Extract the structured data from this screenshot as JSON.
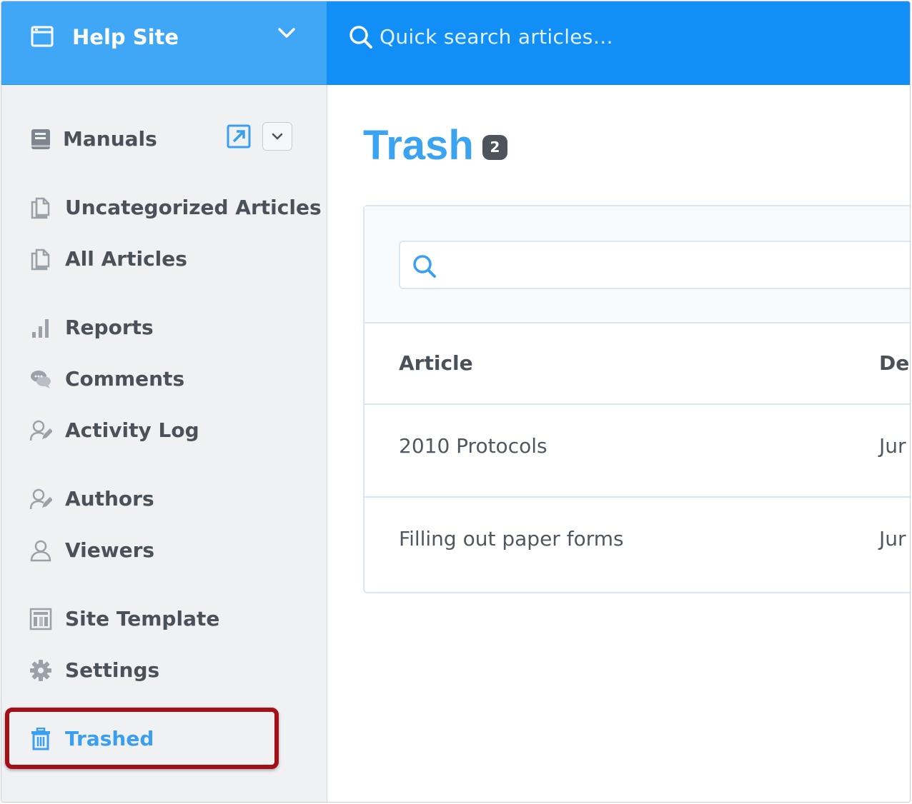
{
  "site": {
    "name": "Help Site"
  },
  "search": {
    "placeholder": "Quick search articles…"
  },
  "sidebar": {
    "items": [
      {
        "label": "Manuals"
      },
      {
        "label": "Uncategorized Articles"
      },
      {
        "label": "All Articles"
      },
      {
        "label": "Reports"
      },
      {
        "label": "Comments"
      },
      {
        "label": "Activity Log"
      },
      {
        "label": "Authors"
      },
      {
        "label": "Viewers"
      },
      {
        "label": "Site Template"
      },
      {
        "label": "Settings"
      },
      {
        "label": "Trashed"
      }
    ]
  },
  "main": {
    "title": "Trash",
    "count": "2",
    "filter": {
      "value": ""
    },
    "table": {
      "columns": [
        "Article",
        "Del"
      ],
      "rows": [
        {
          "article": "2010 Protocols",
          "date": "Jur"
        },
        {
          "article": "Filling out paper forms",
          "date": "Jur"
        }
      ]
    }
  },
  "colors": {
    "accent": "#3aa3f2",
    "top_bar_left": "#3fa7f6",
    "top_bar_right": "#118ff7",
    "highlight": "#a31117"
  }
}
